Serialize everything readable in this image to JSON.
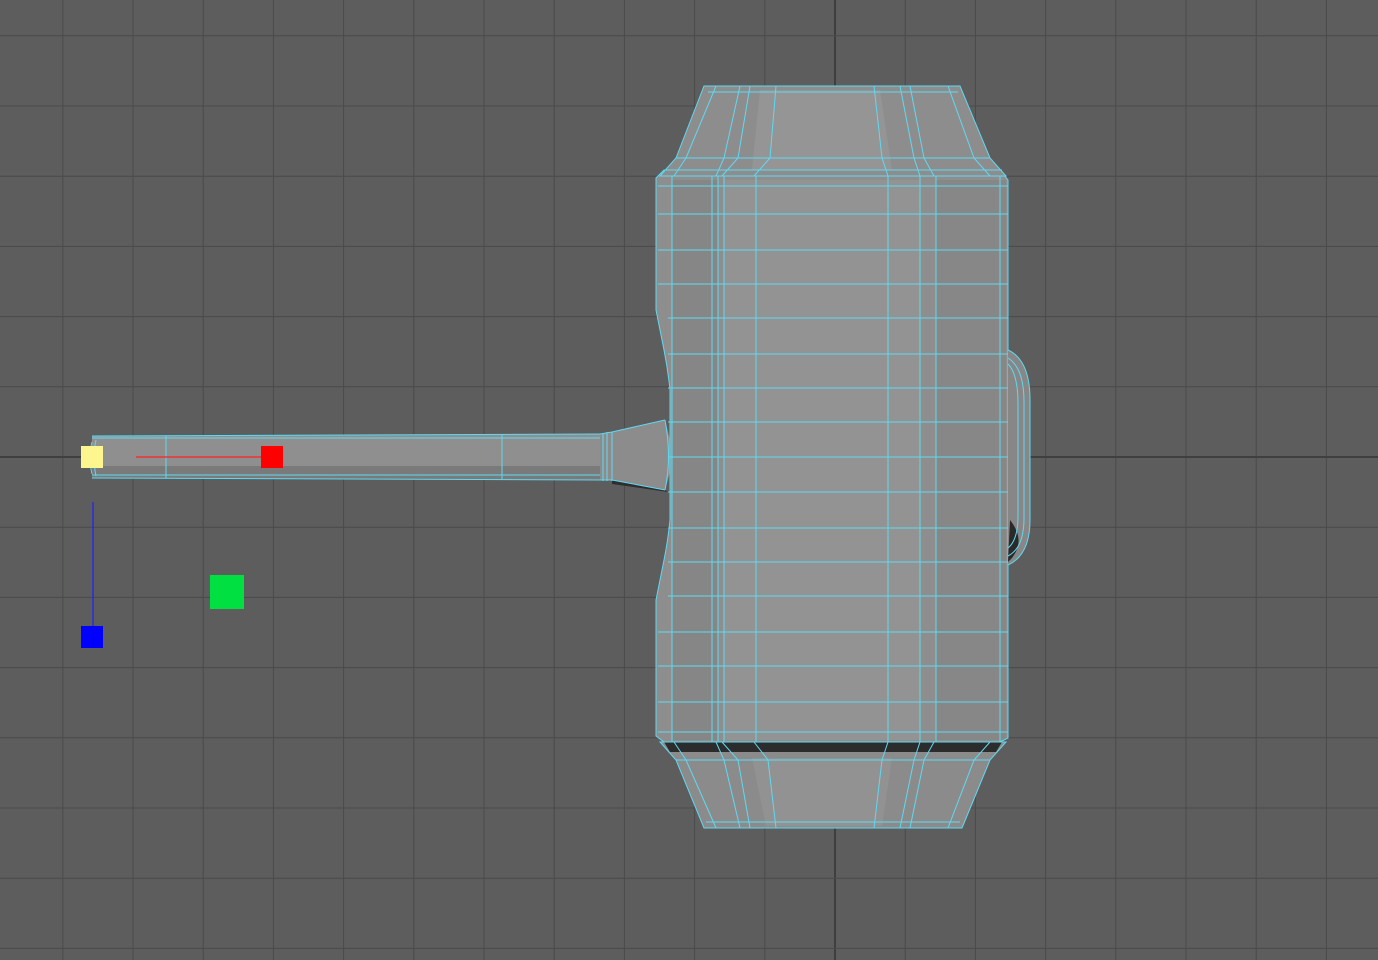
{
  "viewport": {
    "view": "orthographic-top",
    "background_color": "#5d5d5d",
    "grid_color": "#4a4a4a",
    "axis_line_color": "#3f3f3f",
    "wire_color": "#5fd9f2",
    "mesh_fill_color": "#8e8e8e",
    "mesh_shadow_color": "#3a3a3a"
  },
  "object": {
    "type": "hammer-mesh",
    "selected": true,
    "parts": [
      "handle",
      "neck",
      "head",
      "cap-front",
      "cap-back",
      "back-knob"
    ]
  },
  "manipulator": {
    "type": "move-tool",
    "handles": {
      "pivot": {
        "color": "#fdf58e"
      },
      "x": {
        "color": "#ff0000"
      },
      "y": {
        "color": "#00e040"
      },
      "z": {
        "color": "#0000ff"
      }
    }
  }
}
